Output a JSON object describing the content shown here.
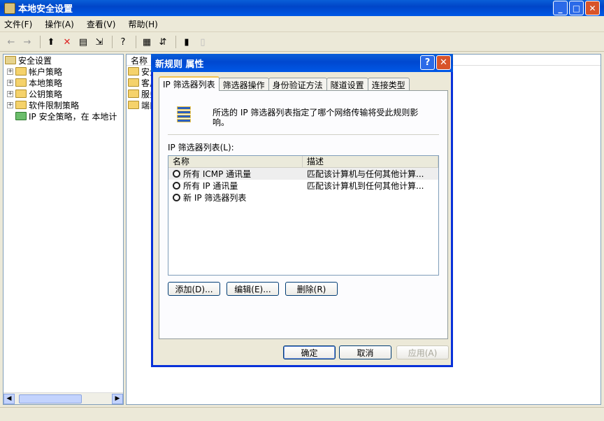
{
  "window": {
    "title": "本地安全设置"
  },
  "menu": [
    "文件(F)",
    "操作(A)",
    "查看(V)",
    "帮助(H)"
  ],
  "tree": {
    "root": "安全设置",
    "items": [
      "帐户策略",
      "本地策略",
      "公钥策略",
      "软件限制策略",
      "IP 安全策略，在 本地计"
    ]
  },
  "right": {
    "header": "名称",
    "rows": [
      "安全",
      "客户",
      "服务",
      "端口"
    ]
  },
  "dialog": {
    "title": "新规则 属性",
    "tabs": [
      "IP 筛选器列表",
      "筛选器操作",
      "身份验证方法",
      "隧道设置",
      "连接类型"
    ],
    "description": "所选的 IP 筛选器列表指定了哪个网络传输将受此规则影响。",
    "list_label": "IP 筛选器列表(L):",
    "columns": [
      "名称",
      "描述"
    ],
    "rows": [
      {
        "name": "所有 ICMP 通讯量",
        "desc": "匹配该计算机与任何其他计算..."
      },
      {
        "name": "所有 IP 通讯量",
        "desc": "匹配该计算机到任何其他计算..."
      },
      {
        "name": "新 IP 筛选器列表",
        "desc": ""
      }
    ],
    "buttons": {
      "add": "添加(D)...",
      "edit": "编辑(E)...",
      "remove": "删除(R)"
    },
    "footer": {
      "ok": "确定",
      "cancel": "取消",
      "apply": "应用(A)"
    }
  }
}
